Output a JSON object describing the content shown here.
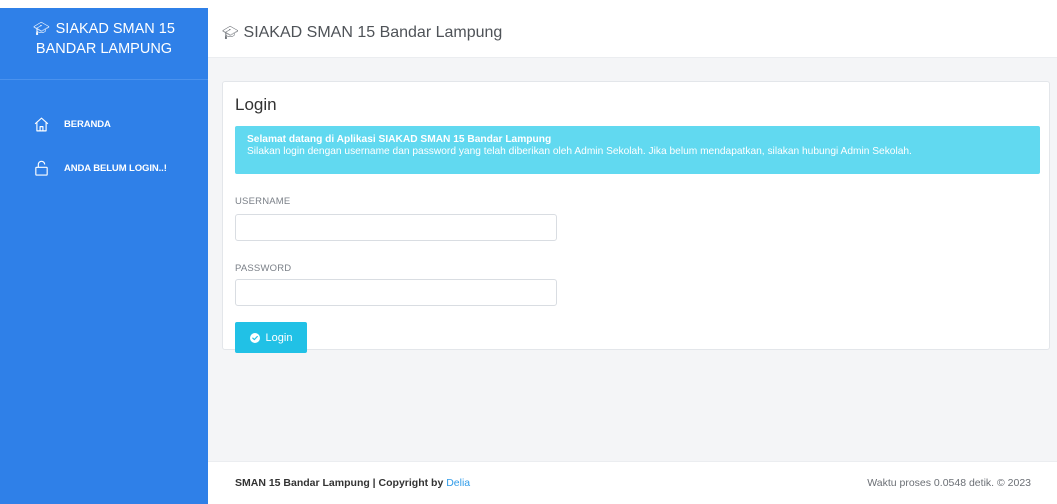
{
  "sidebar": {
    "brand_line1": "SIAKAD SMAN 15",
    "brand_line2": "BANDAR LAMPUNG",
    "items": [
      {
        "label": "BERANDA",
        "icon": "home-icon"
      },
      {
        "label": "ANDA BELUM LOGIN..!",
        "icon": "unlock-icon"
      }
    ]
  },
  "header": {
    "title": "SIAKAD SMAN 15 Bandar Lampung",
    "icon": "graduation-cap-icon"
  },
  "login": {
    "title": "Login",
    "alert_title": "Selamat datang di Aplikasi SIAKAD SMAN 15 Bandar Lampung",
    "alert_text": "Silakan login dengan username dan password yang telah diberikan oleh Admin Sekolah. Jika belum mendapatkan, silakan hubungi Admin Sekolah.",
    "username_label": "USERNAME",
    "username_value": "",
    "password_label": "PASSWORD",
    "password_value": "",
    "button_label": "Login",
    "button_icon": "check-circle-icon"
  },
  "footer": {
    "left_text": "SMAN 15 Bandar Lampung | Copyright by ",
    "author": "Delia",
    "right_text": "Waktu proses 0.0548 detik. © 2023"
  },
  "colors": {
    "sidebar": "#2f80e8",
    "alert": "#61d9f0",
    "button": "#21c1e6",
    "link": "#2f9be8"
  }
}
